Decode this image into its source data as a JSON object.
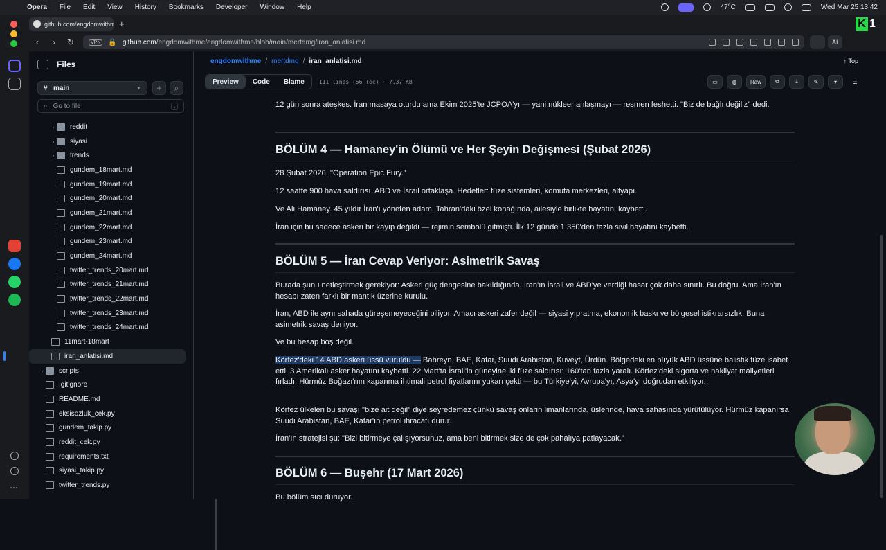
{
  "menubar": {
    "app": "Opera",
    "items": [
      "File",
      "Edit",
      "View",
      "History",
      "Bookmarks",
      "Developer",
      "Window",
      "Help"
    ],
    "temp": "47°C",
    "datetime": "Wed Mar 25  13:42"
  },
  "tab": {
    "title": "github.com/engdomwithme/mertdmg"
  },
  "address": {
    "vpn": "VPN",
    "domain": "github.com",
    "path": "/engdomwithme/engdomwithme/blob/main/mertdmg/iran_anlatisi.md",
    "ai": "AI"
  },
  "files_panel": {
    "title": "Files",
    "branch": "main",
    "goto_placeholder": "Go to file",
    "goto_shortcut": "t",
    "tree": [
      {
        "type": "folder",
        "name": "reddit",
        "indent": 2,
        "chev": "›"
      },
      {
        "type": "folder",
        "name": "siyasi",
        "indent": 2,
        "chev": "›"
      },
      {
        "type": "folder",
        "name": "trends",
        "indent": 2,
        "chev": "›"
      },
      {
        "type": "file",
        "name": "gundem_18mart.md",
        "indent": 2
      },
      {
        "type": "file",
        "name": "gundem_19mart.md",
        "indent": 2
      },
      {
        "type": "file",
        "name": "gundem_20mart.md",
        "indent": 2
      },
      {
        "type": "file",
        "name": "gundem_21mart.md",
        "indent": 2
      },
      {
        "type": "file",
        "name": "gundem_22mart.md",
        "indent": 2
      },
      {
        "type": "file",
        "name": "gundem_23mart.md",
        "indent": 2
      },
      {
        "type": "file",
        "name": "gundem_24mart.md",
        "indent": 2
      },
      {
        "type": "file",
        "name": "twitter_trends_20mart.md",
        "indent": 2
      },
      {
        "type": "file",
        "name": "twitter_trends_21mart.md",
        "indent": 2
      },
      {
        "type": "file",
        "name": "twitter_trends_22mart.md",
        "indent": 2
      },
      {
        "type": "file",
        "name": "twitter_trends_23mart.md",
        "indent": 2
      },
      {
        "type": "file",
        "name": "twitter_trends_24mart.md",
        "indent": 2
      },
      {
        "type": "file",
        "name": "11mart-18mart",
        "indent": 1
      },
      {
        "type": "file",
        "name": "iran_anlatisi.md",
        "indent": 1,
        "selected": true
      },
      {
        "type": "folder",
        "name": "scripts",
        "indent": 0,
        "chev": "›"
      },
      {
        "type": "file",
        "name": ".gitignore",
        "indent": 0
      },
      {
        "type": "file",
        "name": "README.md",
        "indent": 0
      },
      {
        "type": "file",
        "name": "eksisozluk_cek.py",
        "indent": 0
      },
      {
        "type": "file",
        "name": "gundem_takip.py",
        "indent": 0
      },
      {
        "type": "file",
        "name": "reddit_cek.py",
        "indent": 0
      },
      {
        "type": "file",
        "name": "requirements.txt",
        "indent": 0
      },
      {
        "type": "file",
        "name": "siyasi_takip.py",
        "indent": 0
      },
      {
        "type": "file",
        "name": "twitter_trends.py",
        "indent": 0
      }
    ]
  },
  "breadcrumb": {
    "owner": "engdomwithme",
    "folder": "mertdmg",
    "file": "iran_anlatisi.md",
    "sep": "/"
  },
  "top_label": "Top",
  "toolbar": {
    "tabs": [
      "Preview",
      "Code",
      "Blame"
    ],
    "active": "Preview",
    "meta": "111 lines (56 loc) · 7.37 KB",
    "raw": "Raw"
  },
  "document": {
    "p0": "12 gün sonra ateşkes. İran masaya oturdu ama Ekim 2025'te JCPOA'yı — yani nükleer anlaşmayı — resmen feshetti. \"Biz de bağlı değiliz\" dedi.",
    "h4": "BÖLÜM 4 — Hamaney'in Ölümü ve Her Şeyin Değişmesi (Şubat 2026)",
    "p1": "28 Şubat 2026. \"Operation Epic Fury.\"",
    "p2": "12 saatte 900 hava saldırısı. ABD ve İsrail ortaklaşa. Hedefler: füze sistemleri, komuta merkezleri, altyapı.",
    "p3": "Ve Ali Hamaney. 45 yıldır İran'ı yöneten adam. Tahran'daki özel konağında, ailesiyle birlikte hayatını kaybetti.",
    "p4": "İran için bu sadece askeri bir kayıp değildi — rejimin sembolü gitmişti. İlk 12 günde 1.350'den fazla sivil hayatını kaybetti.",
    "h5": "BÖLÜM 5 — İran Cevap Veriyor: Asimetrik Savaş",
    "p5": "Burada şunu netleştirmek gerekiyor: Askeri güç dengesine bakıldığında, İran'ın İsrail ve ABD'ye verdiği hasar çok daha sınırlı. Bu doğru. Ama İran'ın hesabı zaten farklı bir mantık üzerine kurulu.",
    "p6": "İran, ABD ile aynı sahada güreşemeyeceğini biliyor. Amacı askeri zafer değil — siyasi yıpratma, ekonomik baskı ve bölgesel istikrarsızlık. Buna asimetrik savaş deniyor.",
    "p7": "Ve bu hesap boş değil.",
    "p8_highlight": "Körfez'deki 14 ABD askeri üssü vuruldu —",
    "p8_rest": " Bahreyn, BAE, Katar, Suudi Arabistan, Kuveyt, Ürdün. Bölgedeki en büyük ABD üssüne balistik füze isabet etti. 3 Amerikalı asker hayatını kaybetti. 22 Mart'ta İsrail'in güneyine iki füze saldırısı: 160'tan fazla yaralı. Körfez'deki sigorta ve nakliyat maliyetleri fırladı. Hürmüz Boğazı'nın kapanma ihtimali petrol fiyatlarını yukarı çekti — bu Türkiye'yi, Avrupa'yı, Asya'yı doğrudan etkiliyor.",
    "p9": "Körfez ülkeleri bu savaşı \"bize ait değil\" diye seyredemez çünkü savaş onların limanlarında, üslerinde, hava sahasında yürütülüyor. Hürmüz kapanırsa Suudi Arabistan, BAE, Katar'ın petrol ihracatı durur.",
    "p10": "İran'ın stratejisi şu: \"Bizi bitirmeye çalışıyorsunuz, ama beni bitirmek size de çok pahalıya patlayacak.\"",
    "h6": "BÖLÜM 6 — Buşehr (17 Mart 2026)",
    "p11": "Bu bölüm sıcı duruyor."
  }
}
